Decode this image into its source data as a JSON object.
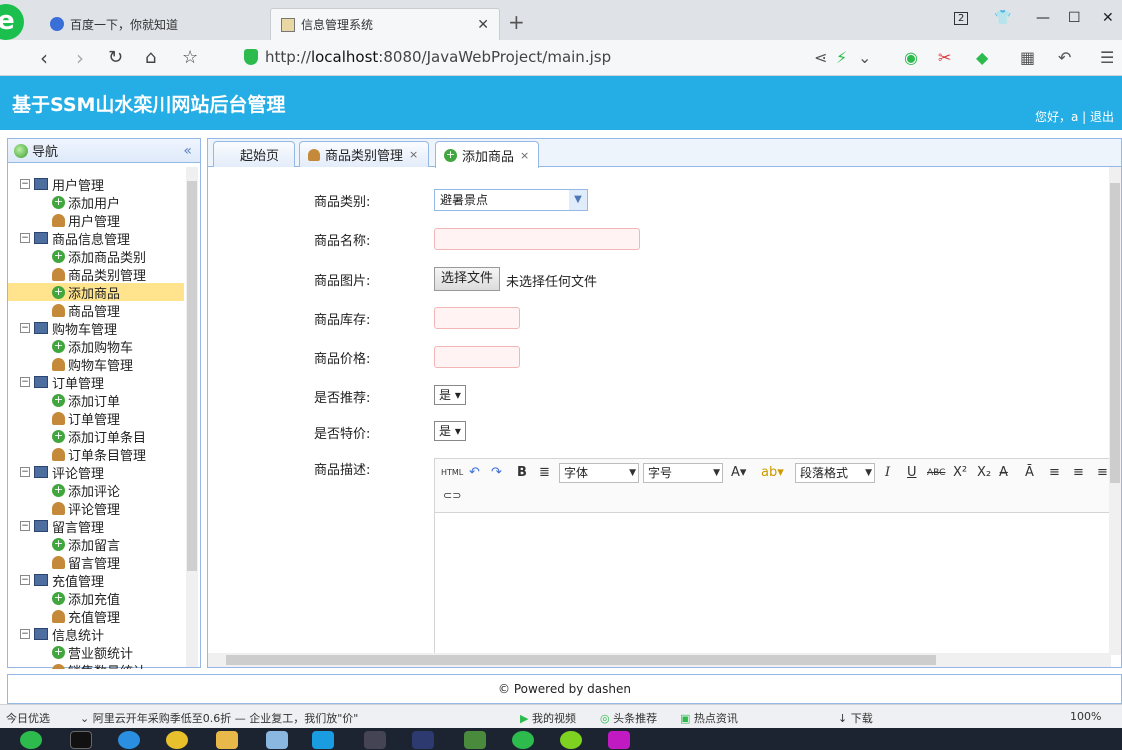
{
  "browser": {
    "tabs": [
      {
        "label": "百度一下，你就知道",
        "active": false
      },
      {
        "label": "信息管理系统",
        "active": true
      }
    ],
    "url_prefix": "http://",
    "url_host": "localhost",
    "url_rest": ":8080/JavaWebProject/main.jsp",
    "tab_count_badge": "2"
  },
  "app": {
    "title": "基于SSM山水栾川网站后台管理",
    "greeting": "您好，a",
    "separator": " | ",
    "logout": "退出"
  },
  "nav": {
    "title": "导航",
    "collapse_glyph": "«",
    "groups": [
      {
        "label": "用户管理",
        "items": [
          "添加用户",
          "用户管理"
        ]
      },
      {
        "label": "商品信息管理",
        "items": [
          "添加商品类别",
          "商品类别管理",
          "添加商品",
          "商品管理"
        ]
      },
      {
        "label": "购物车管理",
        "items": [
          "添加购物车",
          "购物车管理"
        ]
      },
      {
        "label": "订单管理",
        "items": [
          "添加订单",
          "订单管理",
          "添加订单条目",
          "订单条目管理"
        ]
      },
      {
        "label": "评论管理",
        "items": [
          "添加评论",
          "评论管理"
        ]
      },
      {
        "label": "留言管理",
        "items": [
          "添加留言",
          "留言管理"
        ]
      },
      {
        "label": "充值管理",
        "items": [
          "添加充值",
          "充值管理"
        ]
      },
      {
        "label": "信息统计",
        "items": [
          "营业额统计",
          "销售数量统计"
        ]
      }
    ],
    "selected": "添加商品"
  },
  "content_tabs": [
    {
      "label": "起始页",
      "closable": false
    },
    {
      "label": "商品类别管理",
      "closable": true
    },
    {
      "label": "添加商品",
      "closable": true,
      "active": true
    }
  ],
  "form": {
    "category_label": "商品类别:",
    "category_value": "避暑景点",
    "name_label": "商品名称:",
    "image_label": "商品图片:",
    "choose_file": "选择文件",
    "no_file": "未选择任何文件",
    "stock_label": "商品库存:",
    "price_label": "商品价格:",
    "recommend_label": "是否推荐:",
    "recommend_value": "是",
    "special_label": "是否特价:",
    "special_value": "是",
    "desc_label": "商品描述:"
  },
  "editor": {
    "html_btn": "HTML",
    "font_family": "字体",
    "font_size": "字号",
    "paragraph": "段落格式"
  },
  "footer": {
    "text": "© Powered by dashen"
  },
  "statusbar": {
    "left": "今日优选",
    "news": "阿里云开年采购季低至0.6折 — 企业复工，我们放\"价\"",
    "video": "我的视频",
    "headline": "头条推荐",
    "hot": "热点资讯",
    "download": "下载",
    "zoom": "100%"
  }
}
